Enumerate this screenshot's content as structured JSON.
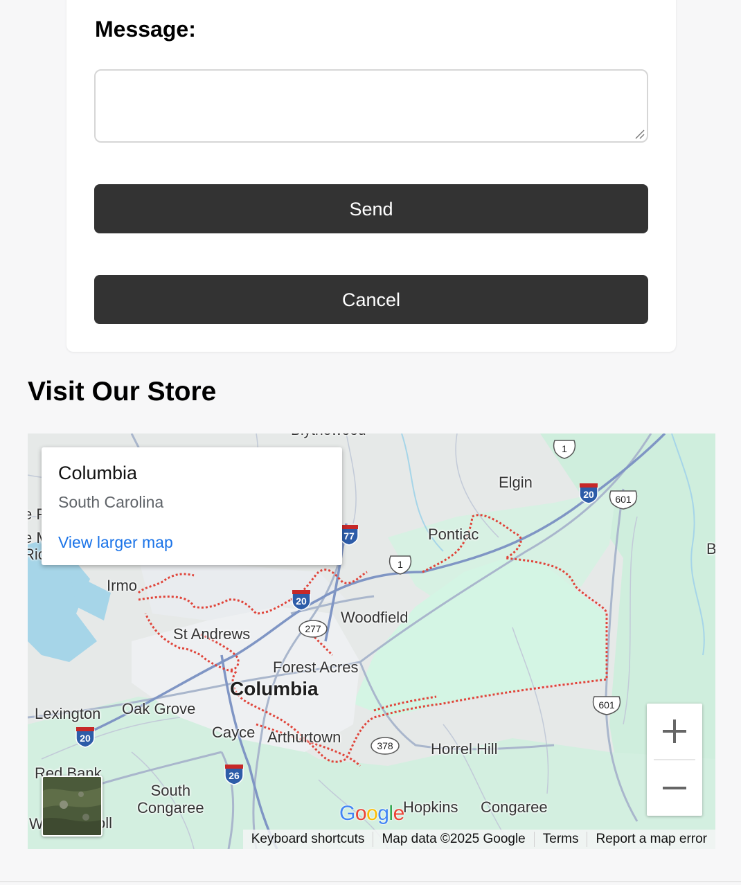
{
  "form": {
    "message_label": "Message:",
    "message_value": "",
    "send_label": "Send",
    "cancel_label": "Cancel"
  },
  "store_section": {
    "title": "Visit Our Store"
  },
  "map": {
    "info_window": {
      "title": "Columbia",
      "subtitle": "South Carolina",
      "link": "View larger map"
    },
    "labels": {
      "columbia": "Columbia",
      "irmo": "Irmo",
      "st_andrews": "St Andrews",
      "forest_acres": "Forest Acres",
      "woodfield": "Woodfield",
      "pontiac": "Pontiac",
      "elgin": "Elgin",
      "lexington": "Lexington",
      "oak_grove": "Oak Grove",
      "cayce": "Cayce",
      "arthurtown": "Arthurtown",
      "horrel_hill": "Horrel Hill",
      "red_bank": "Red Bank",
      "south_congaree": "South\nCongaree",
      "hopkins": "Hopkins",
      "congaree": "Congaree",
      "blythewood_partial": "Blythewood",
      "edge_b": "B",
      "edge_left_1": "e F",
      "edge_left_2": "e M",
      "edge_left_3": "Ric",
      "edge_bottom_left": "W",
      "edge_bottom_oll": "oll"
    },
    "shields": {
      "i20_a": "20",
      "i20_b": "20",
      "i20_c": "20",
      "i26": "26",
      "i77": "77",
      "us1_a": "1",
      "us1_b": "1",
      "sc277": "277",
      "sc378": "378",
      "us601_a": "601",
      "us601_b": "601"
    },
    "logo": "Google",
    "attribution": {
      "shortcuts": "Keyboard shortcuts",
      "data": "Map data ©2025 Google",
      "terms": "Terms",
      "report": "Report a map error"
    },
    "colors": {
      "boundary": "#e0443a",
      "park": "#d5f4e2",
      "water": "#a6d5e8",
      "road": "#a8b5cc",
      "interstate": "#4a72b8"
    }
  }
}
